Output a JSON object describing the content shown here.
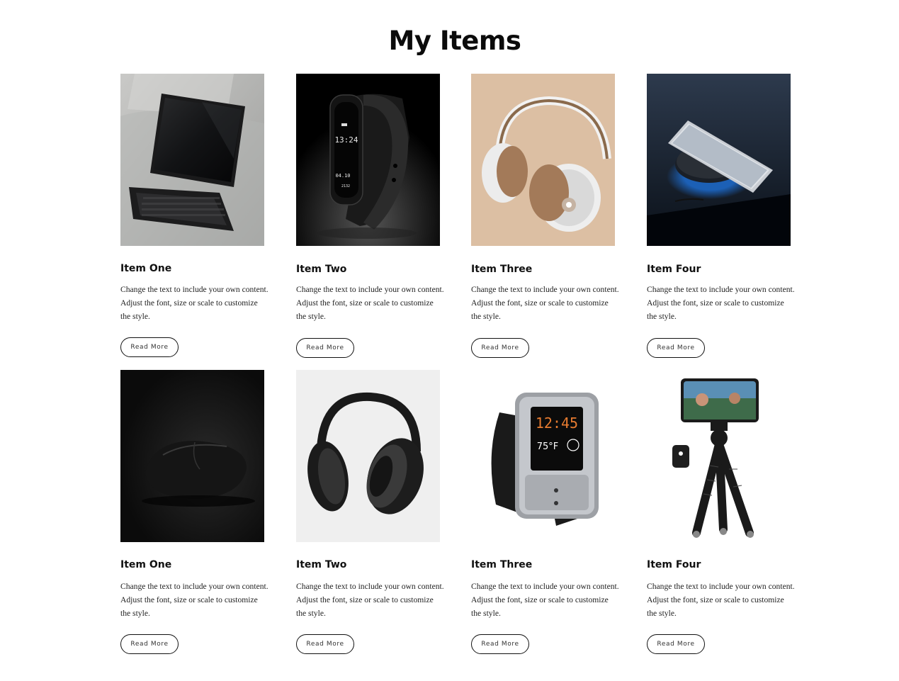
{
  "page": {
    "title": "My Items"
  },
  "items": [
    {
      "title": "Item One",
      "desc_line1": "Change the text to include your own content.",
      "desc_line2": "Adjust the font, size or scale to customize",
      "desc_line3": "the style.",
      "button": "Read More",
      "image": "tablet-keyboard-image"
    },
    {
      "title": "Item Two",
      "desc_line1": "Change the text to include your own content.",
      "desc_line2": "Adjust the font, size or scale to customize",
      "desc_line3": "the style.",
      "button": "Read More",
      "image": "fitness-band-image"
    },
    {
      "title": "Item Three",
      "desc_line1": "Change the text to include your own content.",
      "desc_line2": "Adjust the font, size or scale to customize",
      "desc_line3": "the style.",
      "button": "Read More",
      "image": "white-headphones-image"
    },
    {
      "title": "Item Four",
      "desc_line1": "Change the text to include your own content.",
      "desc_line2": "Adjust the font, size or scale to customize",
      "desc_line3": "the style.",
      "button": "Read More",
      "image": "phone-wireless-charger-image"
    },
    {
      "title": "Item One",
      "desc_line1": "Change the text to include your own content.",
      "desc_line2": "Adjust the font, size or scale to customize",
      "desc_line3": "the style.",
      "button": "Read More",
      "image": "black-mouse-image"
    },
    {
      "title": "Item Two",
      "desc_line1": "Change the text to include your own content.",
      "desc_line2": "Adjust the font, size or scale to customize",
      "desc_line3": "the style.",
      "button": "Read More",
      "image": "black-headphones-image"
    },
    {
      "title": "Item Three",
      "desc_line1": "Change the text to include your own content.",
      "desc_line2": "Adjust the font, size or scale to customize",
      "desc_line3": "the style.",
      "button": "Read More",
      "image": "smartwatch-image"
    },
    {
      "title": "Item Four",
      "desc_line1": "Change the text to include your own content.",
      "desc_line2": "Adjust the font, size or scale to customize",
      "desc_line3": "the style.",
      "button": "Read More",
      "image": "phone-tripod-image"
    }
  ],
  "screen_text": {
    "band_time": "13:24",
    "band_date": "04.10",
    "band_steps": "2132",
    "watch_time": "12:45",
    "watch_temp": "75°F"
  }
}
